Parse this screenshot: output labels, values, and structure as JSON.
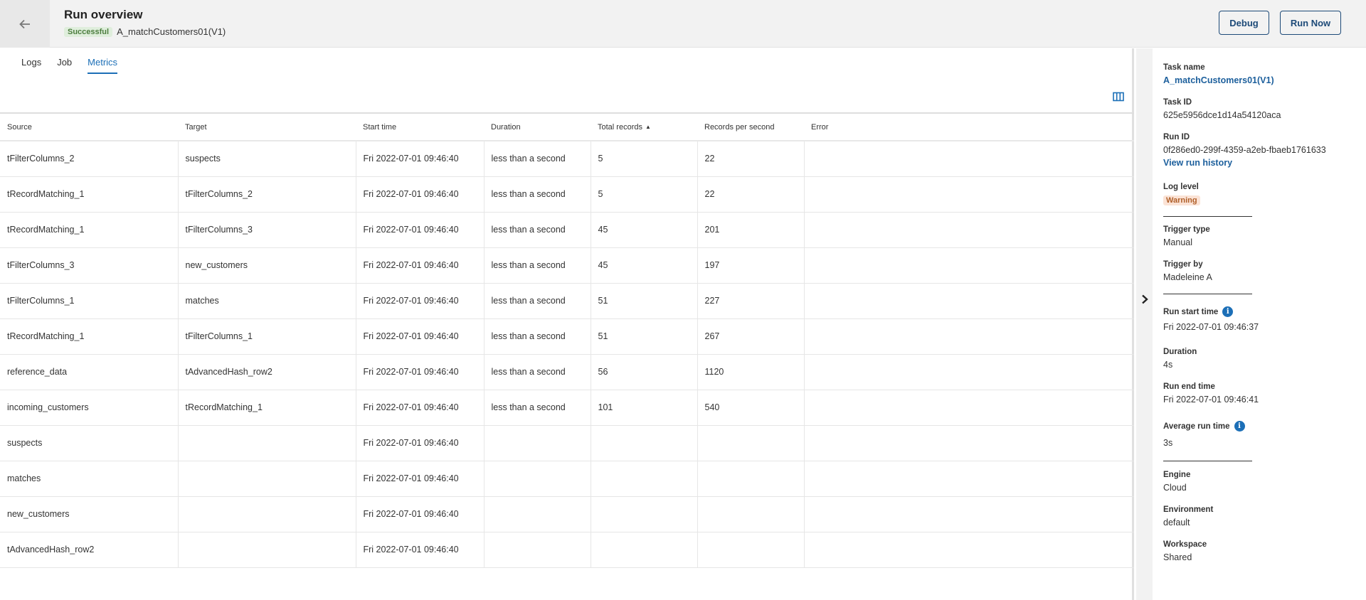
{
  "header": {
    "title": "Run overview",
    "status_badge": "Successful",
    "task_name": "A_matchCustomers01(V1)",
    "debug_label": "Debug",
    "run_now_label": "Run Now"
  },
  "tabs": [
    {
      "label": "Logs",
      "active": false
    },
    {
      "label": "Job",
      "active": false
    },
    {
      "label": "Metrics",
      "active": true
    }
  ],
  "table": {
    "columns": [
      "Source",
      "Target",
      "Start time",
      "Duration",
      "Total records",
      "Records per second",
      "Error"
    ],
    "sorted_column": "Total records",
    "sort_direction": "ascending",
    "rows": [
      [
        "tFilterColumns_2",
        "suspects",
        "Fri 2022-07-01 09:46:40",
        "less than a second",
        "5",
        "22",
        ""
      ],
      [
        "tRecordMatching_1",
        "tFilterColumns_2",
        "Fri 2022-07-01 09:46:40",
        "less than a second",
        "5",
        "22",
        ""
      ],
      [
        "tRecordMatching_1",
        "tFilterColumns_3",
        "Fri 2022-07-01 09:46:40",
        "less than a second",
        "45",
        "201",
        ""
      ],
      [
        "tFilterColumns_3",
        "new_customers",
        "Fri 2022-07-01 09:46:40",
        "less than a second",
        "45",
        "197",
        ""
      ],
      [
        "tFilterColumns_1",
        "matches",
        "Fri 2022-07-01 09:46:40",
        "less than a second",
        "51",
        "227",
        ""
      ],
      [
        "tRecordMatching_1",
        "tFilterColumns_1",
        "Fri 2022-07-01 09:46:40",
        "less than a second",
        "51",
        "267",
        ""
      ],
      [
        "reference_data",
        "tAdvancedHash_row2",
        "Fri 2022-07-01 09:46:40",
        "less than a second",
        "56",
        "1120",
        ""
      ],
      [
        "incoming_customers",
        "tRecordMatching_1",
        "Fri 2022-07-01 09:46:40",
        "less than a second",
        "101",
        "540",
        ""
      ],
      [
        "suspects",
        "",
        "Fri 2022-07-01 09:46:40",
        "",
        "",
        "",
        ""
      ],
      [
        "matches",
        "",
        "Fri 2022-07-01 09:46:40",
        "",
        "",
        "",
        ""
      ],
      [
        "new_customers",
        "",
        "Fri 2022-07-01 09:46:40",
        "",
        "",
        "",
        ""
      ],
      [
        "tAdvancedHash_row2",
        "",
        "Fri 2022-07-01 09:46:40",
        "",
        "",
        "",
        ""
      ]
    ]
  },
  "side_panel": {
    "task_name_label": "Task name",
    "task_name_value": "A_matchCustomers01(V1)",
    "task_id_label": "Task ID",
    "task_id_value": "625e5956dce1d14a54120aca",
    "run_id_label": "Run ID",
    "run_id_value": "0f286ed0-299f-4359-a2eb-fbaeb1761633",
    "view_history_label": "View run history",
    "log_level_label": "Log level",
    "log_level_value": "Warning",
    "trigger_type_label": "Trigger type",
    "trigger_type_value": "Manual",
    "trigger_by_label": "Trigger by",
    "trigger_by_value": "Madeleine A",
    "run_start_label": "Run start time",
    "run_start_value": "Fri 2022-07-01 09:46:37",
    "duration_label": "Duration",
    "duration_value": "4s",
    "run_end_label": "Run end time",
    "run_end_value": "Fri 2022-07-01 09:46:41",
    "avg_run_label": "Average run time",
    "avg_run_value": "3s",
    "engine_label": "Engine",
    "engine_value": "Cloud",
    "environment_label": "Environment",
    "environment_value": "default",
    "workspace_label": "Workspace",
    "workspace_value": "Shared"
  },
  "colors": {
    "accent": "#1c6fb7",
    "button_border": "#1d4a78",
    "success_bg": "#dfeedc",
    "warning_bg": "#fbe3d6"
  }
}
